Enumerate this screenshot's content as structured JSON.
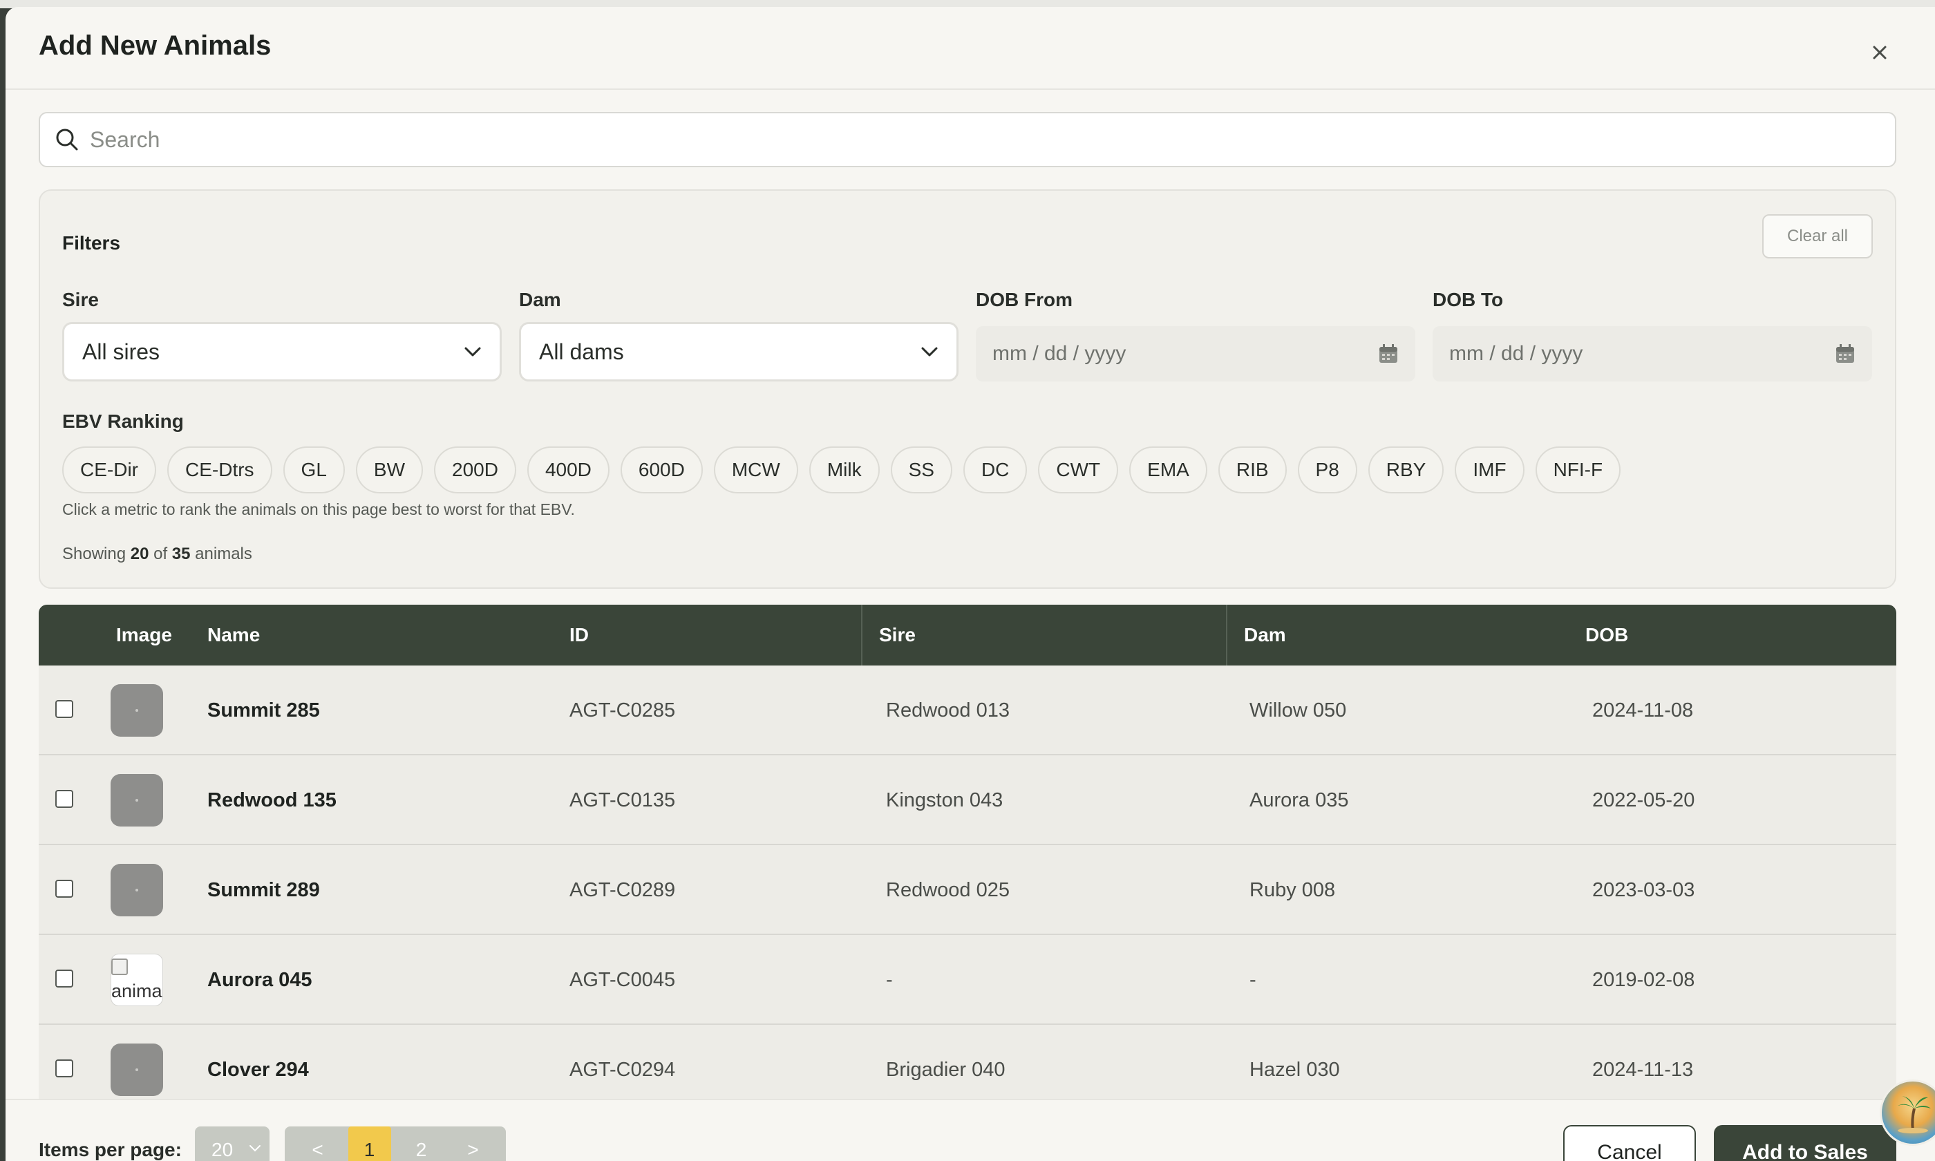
{
  "modal": {
    "title": "Add New Animals"
  },
  "search": {
    "placeholder": "Search"
  },
  "filters": {
    "title": "Filters",
    "clear_all": "Clear all",
    "sire_label": "Sire",
    "sire_value": "All sires",
    "dam_label": "Dam",
    "dam_value": "All dams",
    "dob_from_label": "DOB From",
    "dob_from_placeholder": "mm / dd / yyyy",
    "dob_to_label": "DOB To",
    "dob_to_placeholder": "mm / dd / yyyy",
    "ebv_label": "EBV Ranking",
    "ebv_chips": [
      "CE-Dir",
      "CE-Dtrs",
      "GL",
      "BW",
      "200D",
      "400D",
      "600D",
      "MCW",
      "Milk",
      "SS",
      "DC",
      "CWT",
      "EMA",
      "RIB",
      "P8",
      "RBY",
      "IMF",
      "NFI-F"
    ],
    "hint": "Click a metric to rank the animals on this page best to worst for that EBV.",
    "showing_prefix": "Showing",
    "showing_count": "20",
    "showing_of": "of",
    "showing_total": "35",
    "showing_suffix": "animals"
  },
  "table": {
    "headers": {
      "image": "Image",
      "name": "Name",
      "id": "ID",
      "sire": "Sire",
      "dam": "Dam",
      "dob": "DOB"
    },
    "rows": [
      {
        "name": "Summit 285",
        "id": "AGT-C0285",
        "sire": "Redwood 013",
        "dam": "Willow 050",
        "dob": "2024-11-08",
        "image": "placeholder"
      },
      {
        "name": "Redwood 135",
        "id": "AGT-C0135",
        "sire": "Kingston 043",
        "dam": "Aurora 035",
        "dob": "2022-05-20",
        "image": "placeholder"
      },
      {
        "name": "Summit 289",
        "id": "AGT-C0289",
        "sire": "Redwood 025",
        "dam": "Ruby 008",
        "dob": "2023-03-03",
        "image": "placeholder"
      },
      {
        "name": "Aurora 045",
        "id": "AGT-C0045",
        "sire": "-",
        "dam": "-",
        "dob": "2019-02-08",
        "image": "broken",
        "image_alt": "anima"
      },
      {
        "name": "Clover 294",
        "id": "AGT-C0294",
        "sire": "Brigadier 040",
        "dam": "Hazel 030",
        "dob": "2024-11-13",
        "image": "placeholder"
      }
    ]
  },
  "footer": {
    "items_per_page_label": "Items per page:",
    "items_per_page_value": "20",
    "pager_prev": "<",
    "pager_pages": [
      "1",
      "2"
    ],
    "pager_current": "1",
    "pager_next": ">",
    "cancel": "Cancel",
    "add": "Add to Sales"
  },
  "colors": {
    "header_bg": "#3a4539",
    "accent_page": "#f2c94c",
    "modal_bg": "#f7f6f2"
  },
  "icons": {
    "close": "close-icon",
    "search": "search-icon",
    "chevron": "chevron-down-icon",
    "calendar": "calendar-icon"
  }
}
